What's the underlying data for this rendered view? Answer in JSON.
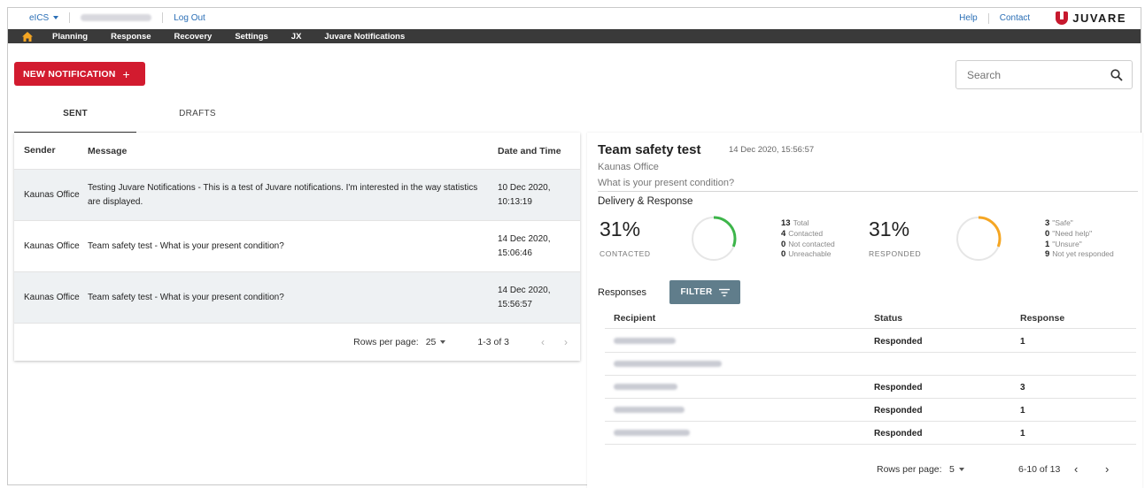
{
  "topbar": {
    "app_menu": "eICS",
    "logout": "Log Out",
    "help": "Help",
    "contact": "Contact",
    "brand": "JUVARE"
  },
  "nav": {
    "items": [
      "Planning",
      "Response",
      "Recovery",
      "Settings",
      "JX",
      "Juvare Notifications"
    ]
  },
  "actions": {
    "new_notification": "NEW NOTIFICATION",
    "new_notification_icon": "plus-icon",
    "search_placeholder": "Search"
  },
  "tabs": [
    {
      "label": "SENT",
      "active": true
    },
    {
      "label": "DRAFTS",
      "active": false
    }
  ],
  "notifications": {
    "columns": {
      "sender": "Sender",
      "message": "Message",
      "date": "Date and Time"
    },
    "rows": [
      {
        "sender": "Kaunas Office",
        "message": "Testing Juvare Notifications - This is a test of Juvare notifications. I'm interested in the way statistics are displayed.",
        "date": "10 Dec 2020, 10:13:19"
      },
      {
        "sender": "Kaunas Office",
        "message": "Team safety test - What is your present condition?",
        "date": "14 Dec 2020, 15:06:46"
      },
      {
        "sender": "Kaunas Office",
        "message": "Team safety test - What is your present condition?",
        "date": "14 Dec 2020, 15:56:57"
      }
    ],
    "pagination": {
      "rows_per_page_label": "Rows per page:",
      "rows_per_page": "25",
      "range": "1-3 of 3"
    }
  },
  "detail": {
    "title": "Team safety test",
    "date": "14 Dec 2020, 15:56:57",
    "office": "Kaunas Office",
    "question": "What is your present condition?",
    "section": "Delivery & Response",
    "contacted": {
      "pct_label": "31%",
      "fraction": 0.31,
      "label": "CONTACTED",
      "color": "#3db54a",
      "stats": [
        {
          "n": "13",
          "t": "Total"
        },
        {
          "n": "4",
          "t": "Contacted"
        },
        {
          "n": "0",
          "t": "Not contacted"
        },
        {
          "n": "0",
          "t": "Unreachable"
        }
      ]
    },
    "responded": {
      "pct_label": "31%",
      "fraction": 0.31,
      "label": "RESPONDED",
      "color": "#f5a623",
      "stats": [
        {
          "n": "3",
          "t": "\"Safe\""
        },
        {
          "n": "0",
          "t": "\"Need help\""
        },
        {
          "n": "1",
          "t": "\"Unsure\""
        },
        {
          "n": "9",
          "t": "Not yet responded"
        }
      ]
    },
    "responses_label": "Responses",
    "filter_label": "FILTER",
    "table": {
      "columns": {
        "recipient": "Recipient",
        "status": "Status",
        "response": "Response"
      },
      "rows": [
        {
          "status": "Responded",
          "response": "1"
        },
        {
          "status": "",
          "response": ""
        },
        {
          "status": "Responded",
          "response": "3"
        },
        {
          "status": "Responded",
          "response": "1"
        },
        {
          "status": "Responded",
          "response": "1"
        }
      ]
    },
    "pagination": {
      "rows_per_page_label": "Rows per page:",
      "rows_per_page": "5",
      "range": "6-10 of 13"
    }
  },
  "colors": {
    "brand_red": "#d21b2f",
    "nav_dark": "#3a3a3a",
    "link_blue": "#2b6fb6",
    "filter_gray": "#607d8b"
  }
}
